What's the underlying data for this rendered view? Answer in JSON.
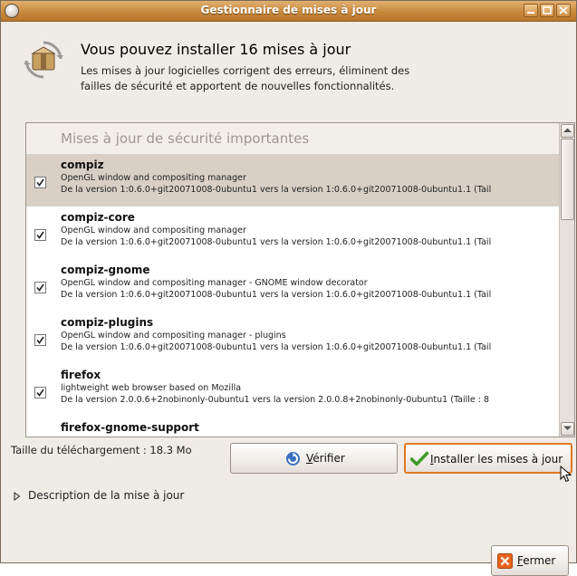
{
  "window": {
    "title": "Gestionnaire de mises à jour"
  },
  "header": {
    "title": "Vous pouvez installer 16 mises à jour",
    "description": "Les mises à jour logicielles corrigent des erreurs, éliminent des failles de sécurité et apportent de nouvelles fonctionnalités."
  },
  "updates": {
    "section_title": "Mises à jour de sécurité importantes",
    "items": [
      {
        "name": "compiz",
        "description": "OpenGL window and compositing manager",
        "version": "De la version 1:0.6.0+git20071008-0ubuntu1 vers la version 1:0.6.0+git20071008-0ubuntu1.1 (Tail",
        "checked": true,
        "selected": true
      },
      {
        "name": "compiz-core",
        "description": "OpenGL window and compositing manager",
        "version": "De la version 1:0.6.0+git20071008-0ubuntu1 vers la version 1:0.6.0+git20071008-0ubuntu1.1 (Tail",
        "checked": true,
        "selected": false
      },
      {
        "name": "compiz-gnome",
        "description": "OpenGL window and compositing manager - GNOME window decorator",
        "version": "De la version 1:0.6.0+git20071008-0ubuntu1 vers la version 1:0.6.0+git20071008-0ubuntu1.1 (Tail",
        "checked": true,
        "selected": false
      },
      {
        "name": "compiz-plugins",
        "description": "OpenGL window and compositing manager - plugins",
        "version": "De la version 1:0.6.0+git20071008-0ubuntu1 vers la version 1:0.6.0+git20071008-0ubuntu1.1 (Tail",
        "checked": true,
        "selected": false
      },
      {
        "name": "firefox",
        "description": "lightweight web browser based on Mozilla",
        "version": "De la version 2.0.0.6+2nobinonly-0ubuntu1 vers la version 2.0.0.8+2nobinonly-0ubuntu1 (Taille : 8",
        "checked": true,
        "selected": false
      },
      {
        "name": "firefox-gnome-support",
        "description": "",
        "version": "",
        "checked": true,
        "selected": false
      }
    ]
  },
  "download_size": "Taille du téléchargement : 18.3 Mo",
  "buttons": {
    "check": {
      "mnemonic": "V",
      "rest": "érifier"
    },
    "install": {
      "mnemonic": "I",
      "rest": "nstaller les mises à jour"
    },
    "close": {
      "mnemonic": "F",
      "rest": "ermer"
    }
  },
  "expander": {
    "label": "Description de la mise à jour"
  },
  "colors": {
    "titlebar": "#c98a3c",
    "selected_row": "#d9cfc5",
    "focus_border": "#e07a1f"
  }
}
